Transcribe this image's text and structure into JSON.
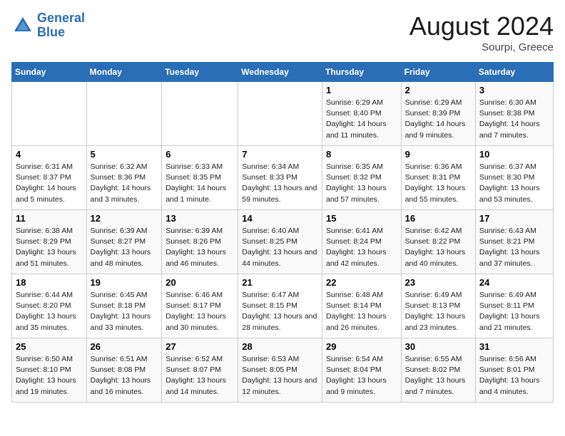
{
  "header": {
    "logo_line1": "General",
    "logo_line2": "Blue",
    "month": "August 2024",
    "location": "Sourpi, Greece"
  },
  "days_of_week": [
    "Sunday",
    "Monday",
    "Tuesday",
    "Wednesday",
    "Thursday",
    "Friday",
    "Saturday"
  ],
  "weeks": [
    [
      {
        "day": "",
        "info": ""
      },
      {
        "day": "",
        "info": ""
      },
      {
        "day": "",
        "info": ""
      },
      {
        "day": "",
        "info": ""
      },
      {
        "day": "1",
        "info": "Sunrise: 6:29 AM\nSunset: 8:40 PM\nDaylight: 14 hours and 11 minutes."
      },
      {
        "day": "2",
        "info": "Sunrise: 6:29 AM\nSunset: 8:39 PM\nDaylight: 14 hours and 9 minutes."
      },
      {
        "day": "3",
        "info": "Sunrise: 6:30 AM\nSunset: 8:38 PM\nDaylight: 14 hours and 7 minutes."
      }
    ],
    [
      {
        "day": "4",
        "info": "Sunrise: 6:31 AM\nSunset: 8:37 PM\nDaylight: 14 hours and 5 minutes."
      },
      {
        "day": "5",
        "info": "Sunrise: 6:32 AM\nSunset: 8:36 PM\nDaylight: 14 hours and 3 minutes."
      },
      {
        "day": "6",
        "info": "Sunrise: 6:33 AM\nSunset: 8:35 PM\nDaylight: 14 hours and 1 minute."
      },
      {
        "day": "7",
        "info": "Sunrise: 6:34 AM\nSunset: 8:33 PM\nDaylight: 13 hours and 59 minutes."
      },
      {
        "day": "8",
        "info": "Sunrise: 6:35 AM\nSunset: 8:32 PM\nDaylight: 13 hours and 57 minutes."
      },
      {
        "day": "9",
        "info": "Sunrise: 6:36 AM\nSunset: 8:31 PM\nDaylight: 13 hours and 55 minutes."
      },
      {
        "day": "10",
        "info": "Sunrise: 6:37 AM\nSunset: 8:30 PM\nDaylight: 13 hours and 53 minutes."
      }
    ],
    [
      {
        "day": "11",
        "info": "Sunrise: 6:38 AM\nSunset: 8:29 PM\nDaylight: 13 hours and 51 minutes."
      },
      {
        "day": "12",
        "info": "Sunrise: 6:39 AM\nSunset: 8:27 PM\nDaylight: 13 hours and 48 minutes."
      },
      {
        "day": "13",
        "info": "Sunrise: 6:39 AM\nSunset: 8:26 PM\nDaylight: 13 hours and 46 minutes."
      },
      {
        "day": "14",
        "info": "Sunrise: 6:40 AM\nSunset: 8:25 PM\nDaylight: 13 hours and 44 minutes."
      },
      {
        "day": "15",
        "info": "Sunrise: 6:41 AM\nSunset: 8:24 PM\nDaylight: 13 hours and 42 minutes."
      },
      {
        "day": "16",
        "info": "Sunrise: 6:42 AM\nSunset: 8:22 PM\nDaylight: 13 hours and 40 minutes."
      },
      {
        "day": "17",
        "info": "Sunrise: 6:43 AM\nSunset: 8:21 PM\nDaylight: 13 hours and 37 minutes."
      }
    ],
    [
      {
        "day": "18",
        "info": "Sunrise: 6:44 AM\nSunset: 8:20 PM\nDaylight: 13 hours and 35 minutes."
      },
      {
        "day": "19",
        "info": "Sunrise: 6:45 AM\nSunset: 8:18 PM\nDaylight: 13 hours and 33 minutes."
      },
      {
        "day": "20",
        "info": "Sunrise: 6:46 AM\nSunset: 8:17 PM\nDaylight: 13 hours and 30 minutes."
      },
      {
        "day": "21",
        "info": "Sunrise: 6:47 AM\nSunset: 8:15 PM\nDaylight: 13 hours and 28 minutes."
      },
      {
        "day": "22",
        "info": "Sunrise: 6:48 AM\nSunset: 8:14 PM\nDaylight: 13 hours and 26 minutes."
      },
      {
        "day": "23",
        "info": "Sunrise: 6:49 AM\nSunset: 8:13 PM\nDaylight: 13 hours and 23 minutes."
      },
      {
        "day": "24",
        "info": "Sunrise: 6:49 AM\nSunset: 8:11 PM\nDaylight: 13 hours and 21 minutes."
      }
    ],
    [
      {
        "day": "25",
        "info": "Sunrise: 6:50 AM\nSunset: 8:10 PM\nDaylight: 13 hours and 19 minutes."
      },
      {
        "day": "26",
        "info": "Sunrise: 6:51 AM\nSunset: 8:08 PM\nDaylight: 13 hours and 16 minutes."
      },
      {
        "day": "27",
        "info": "Sunrise: 6:52 AM\nSunset: 8:07 PM\nDaylight: 13 hours and 14 minutes."
      },
      {
        "day": "28",
        "info": "Sunrise: 6:53 AM\nSunset: 8:05 PM\nDaylight: 13 hours and 12 minutes."
      },
      {
        "day": "29",
        "info": "Sunrise: 6:54 AM\nSunset: 8:04 PM\nDaylight: 13 hours and 9 minutes."
      },
      {
        "day": "30",
        "info": "Sunrise: 6:55 AM\nSunset: 8:02 PM\nDaylight: 13 hours and 7 minutes."
      },
      {
        "day": "31",
        "info": "Sunrise: 6:56 AM\nSunset: 8:01 PM\nDaylight: 13 hours and 4 minutes."
      }
    ]
  ]
}
